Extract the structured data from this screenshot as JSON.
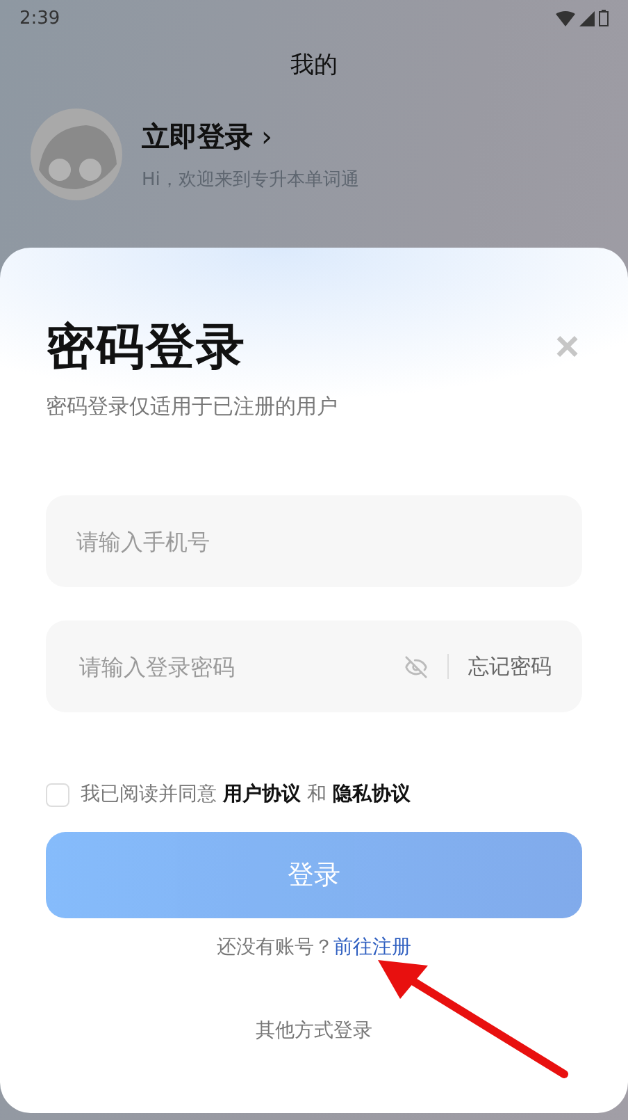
{
  "status_bar": {
    "time": "2:39"
  },
  "header": {
    "title": "我的"
  },
  "profile": {
    "name": "立即登录",
    "chevron": "›",
    "greeting": "Hi，欢迎来到专升本单词通"
  },
  "login_sheet": {
    "title": "密码登录",
    "close": "×",
    "subtitle": "密码登录仅适用于已注册的用户",
    "phone_field": {
      "placeholder": "请输入手机号"
    },
    "password_field": {
      "placeholder": "请输入登录密码",
      "password_hidden": true,
      "forgot": "忘记密码"
    },
    "agreement": {
      "checked": false,
      "text": "我已阅读并同意 **用户协议** 和 **隐私协议**"
    },
    "login_button": {
      "label": "登录",
      "disabled": true
    },
    "register": {
      "prompt": "还没有账号？",
      "link": "前往注册"
    },
    "other_login": "其他方式登录"
  }
}
